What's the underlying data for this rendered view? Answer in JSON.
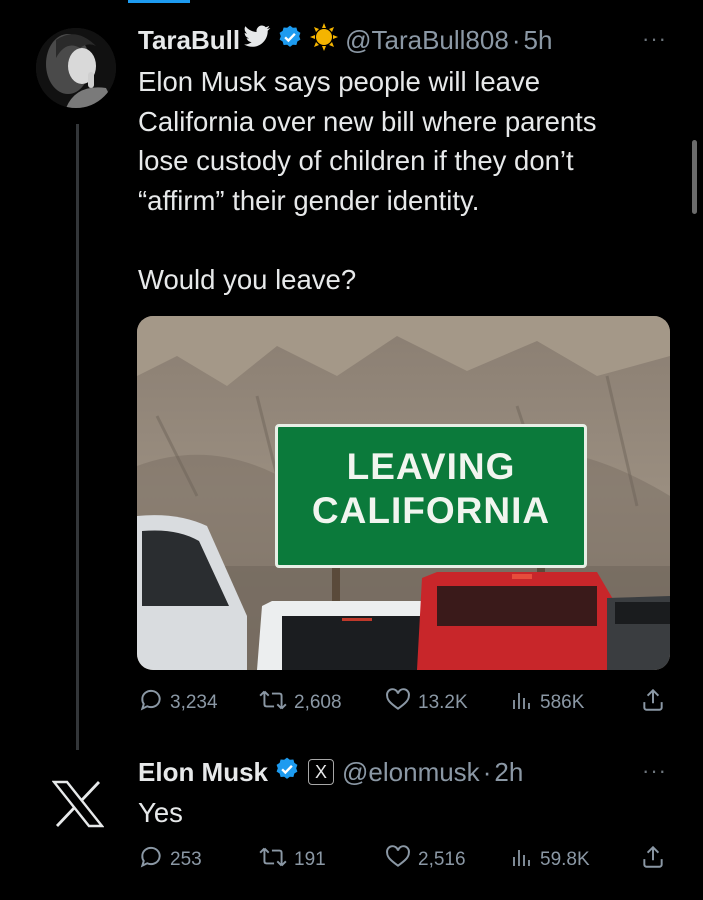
{
  "tweet": {
    "author_name": "TaraBull",
    "handle": "@TaraBull808",
    "separator": "·",
    "time": "5h",
    "text_lines": [
      "Elon Musk says people will leave",
      "California over new bill where parents",
      "lose custody of children if they don’t",
      "“affirm” their gender identity."
    ],
    "question": "Would you leave?",
    "media": {
      "sign_line1": "LEAVING",
      "sign_line2": "CALIFORNIA"
    },
    "stats": {
      "replies": "3,234",
      "retweets": "2,608",
      "likes": "13.2K",
      "views": "586K"
    }
  },
  "reply": {
    "author_name": "Elon Musk",
    "handle": "@elonmusk",
    "separator": "·",
    "time": "2h",
    "affiliate_badge": "X",
    "text": "Yes",
    "stats": {
      "replies": "253",
      "retweets": "191",
      "likes": "2,516",
      "views": "59.8K"
    }
  },
  "more_label": "···",
  "colors": {
    "background": "#000000",
    "verified_blue": "#1d9bf0",
    "muted_text": "#8b98a5",
    "sign_green": "#0b7a3b",
    "gold_badge": "#f4b400"
  },
  "icons": [
    "twitter-bird-icon",
    "verified-badge-icon",
    "sun-badge-icon",
    "x-logo-icon",
    "reply-icon",
    "retweet-icon",
    "like-icon",
    "views-icon",
    "share-icon"
  ]
}
